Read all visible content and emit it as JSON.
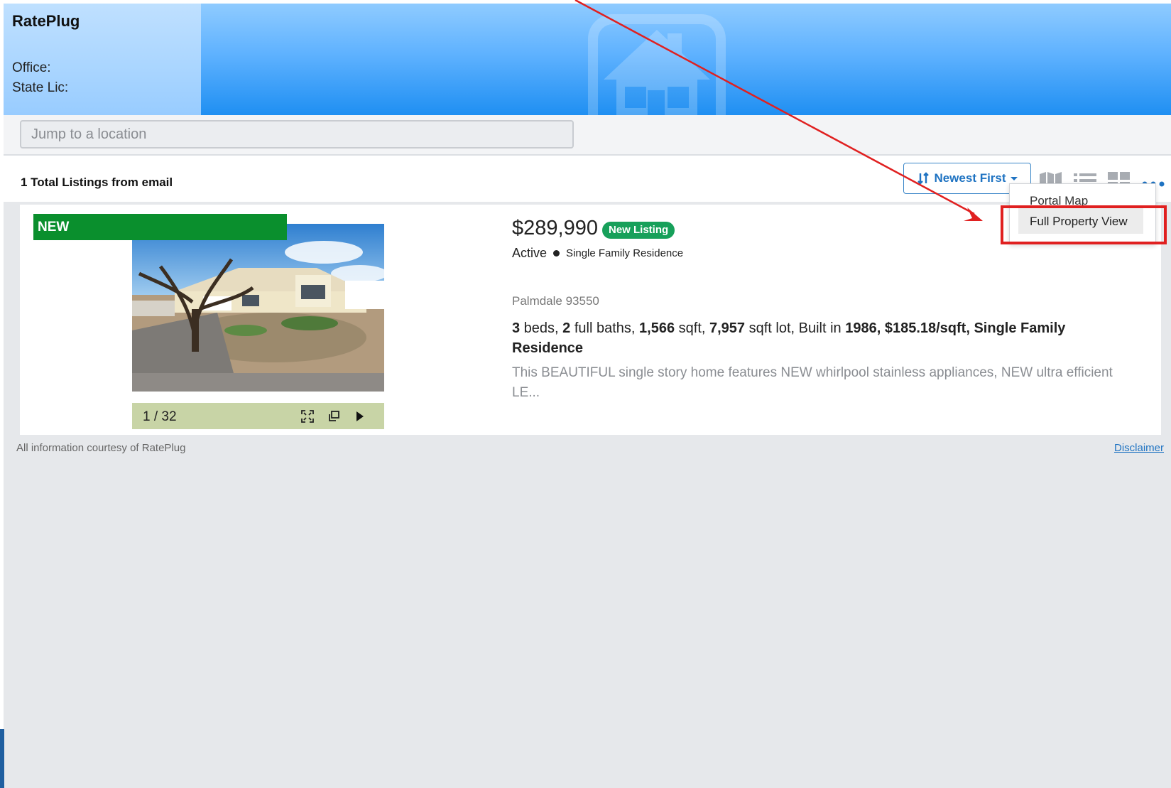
{
  "header": {
    "brand": "RatePlug",
    "office_label": "Office:",
    "state_lic_label": "State Lic:"
  },
  "search": {
    "placeholder": "Jump to a location"
  },
  "toolbar": {
    "total_listings": "1 Total Listings from email",
    "sort_label": "Newest First",
    "view_icons": [
      "map-view-icon",
      "list-view-icon",
      "grid-view-icon",
      "more-options-icon"
    ]
  },
  "dropdown": {
    "items": [
      "Portal Map",
      "Full Property View"
    ],
    "highlighted": "Full Property View"
  },
  "listing": {
    "banner": "NEW",
    "photo_counter": "1 / 32",
    "price": "$289,990",
    "badge": "New Listing",
    "status": "Active",
    "property_type": "Single Family Residence",
    "location": "Palmdale 93550",
    "beds": "3",
    "beds_label": " beds, ",
    "baths": "2",
    "baths_label": " full baths, ",
    "sqft": "1,566",
    "sqft_label": " sqft, ",
    "lot": "7,957",
    "lot_label": " sqft lot, Built in ",
    "year_built": "1986, $185.18/sqft, Single Family Residence",
    "description": "This BEAUTIFUL single story home features NEW whirlpool stainless appliances, NEW ultra efficient LE..."
  },
  "footer": {
    "courtesy": "All information courtesy of RatePlug",
    "disclaimer": "Disclaimer"
  },
  "colors": {
    "header_blue": "#1f8ff2",
    "new_banner": "#0a8f2d",
    "badge_green": "#17a05a",
    "link_blue": "#1f73c2",
    "highlight_red": "#e02020"
  }
}
